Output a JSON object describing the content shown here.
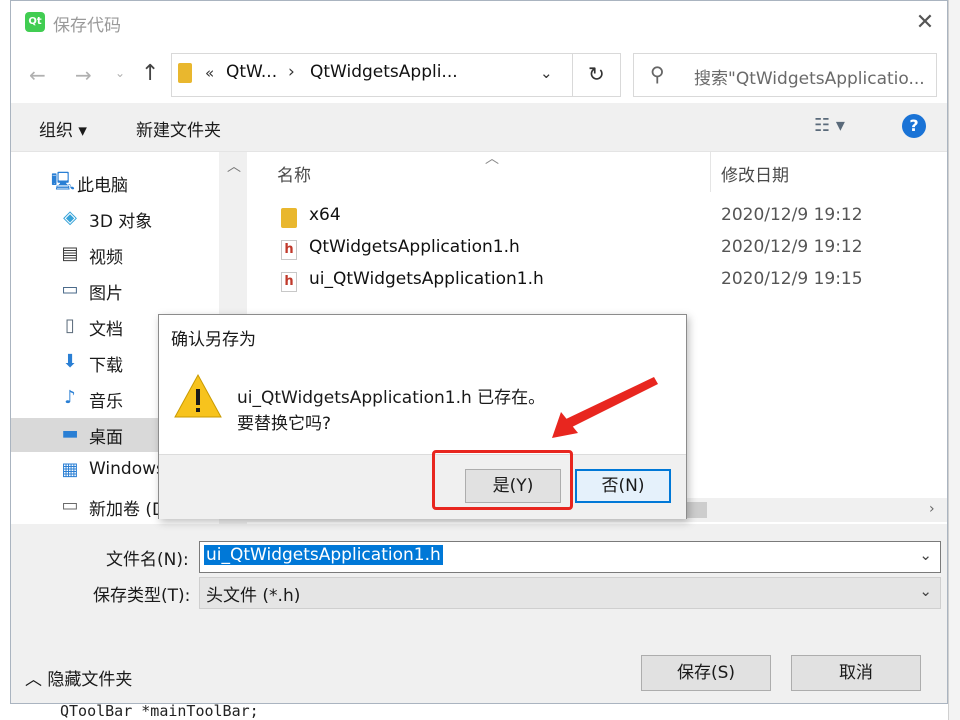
{
  "window": {
    "title": "保存代码",
    "app_icon_text": "Qt"
  },
  "nav": {
    "breadcrumb_overflow": "«",
    "breadcrumb": [
      "QtW...",
      "QtWidgetsAppli..."
    ],
    "search_placeholder": "搜索\"QtWidgetsApplicatio..."
  },
  "toolbar": {
    "organize": "组织 ▾",
    "new_folder": "新建文件夹"
  },
  "sidebar": {
    "items": [
      {
        "label": "此电脑",
        "icon": "computer-icon",
        "root": true
      },
      {
        "label": "3D 对象",
        "icon": "cube-icon"
      },
      {
        "label": "视频",
        "icon": "video-icon"
      },
      {
        "label": "图片",
        "icon": "picture-icon"
      },
      {
        "label": "文档",
        "icon": "document-icon"
      },
      {
        "label": "下载",
        "icon": "download-icon"
      },
      {
        "label": "音乐",
        "icon": "music-icon"
      },
      {
        "label": "桌面",
        "icon": "desktop-icon",
        "selected": true
      },
      {
        "label": "Windows",
        "icon": "windows-drive-icon"
      },
      {
        "label": "新加卷 (D",
        "icon": "drive-icon"
      }
    ]
  },
  "files": {
    "col_name": "名称",
    "col_date": "修改日期",
    "rows": [
      {
        "name": "x64",
        "date": "2020/12/9 19:12",
        "icon": "folder-icon"
      },
      {
        "name": "QtWidgetsApplication1.h",
        "date": "2020/12/9 19:12",
        "icon": "header-file-icon"
      },
      {
        "name": "ui_QtWidgetsApplication1.h",
        "date": "2020/12/9 19:15",
        "icon": "header-file-icon"
      }
    ]
  },
  "form": {
    "filename_label": "文件名(N):",
    "filename_value": "ui_QtWidgetsApplication1.h",
    "filetype_label": "保存类型(T):",
    "filetype_value": "头文件 (*.h)",
    "hide_folders": "隐藏文件夹",
    "save": "保存(S)",
    "cancel": "取消"
  },
  "confirm": {
    "title": "确认另存为",
    "line1": "ui_QtWidgetsApplication1.h 已存在。",
    "line2": "要替换它吗?",
    "yes": "是(Y)",
    "no": "否(N)"
  },
  "background": {
    "code_line": "QToolBar *mainToolBar;"
  },
  "colors": {
    "accent": "#0078d7",
    "annotation_red": "#e8261f",
    "help_blue": "#1a73d6"
  }
}
